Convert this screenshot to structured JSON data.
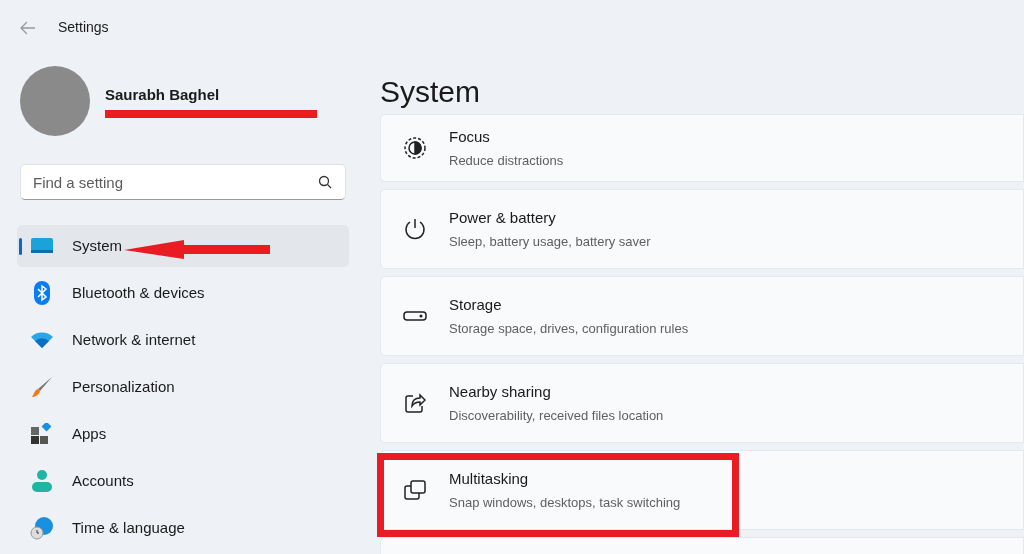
{
  "window": {
    "title": "Settings"
  },
  "profile": {
    "name": "Saurabh Baghel"
  },
  "search": {
    "placeholder": "Find a setting"
  },
  "sidebar": {
    "items": [
      {
        "label": "System",
        "selected": true
      },
      {
        "label": "Bluetooth & devices",
        "selected": false
      },
      {
        "label": "Network & internet",
        "selected": false
      },
      {
        "label": "Personalization",
        "selected": false
      },
      {
        "label": "Apps",
        "selected": false
      },
      {
        "label": "Accounts",
        "selected": false
      },
      {
        "label": "Time & language",
        "selected": false
      }
    ]
  },
  "page": {
    "title": "System",
    "cards": [
      {
        "title": "Focus",
        "subtitle": "Reduce distractions"
      },
      {
        "title": "Power & battery",
        "subtitle": "Sleep, battery usage, battery saver"
      },
      {
        "title": "Storage",
        "subtitle": "Storage space, drives, configuration rules"
      },
      {
        "title": "Nearby sharing",
        "subtitle": "Discoverability, received files location"
      },
      {
        "title": "Multitasking",
        "subtitle": "Snap windows, desktops, task switching"
      }
    ]
  }
}
